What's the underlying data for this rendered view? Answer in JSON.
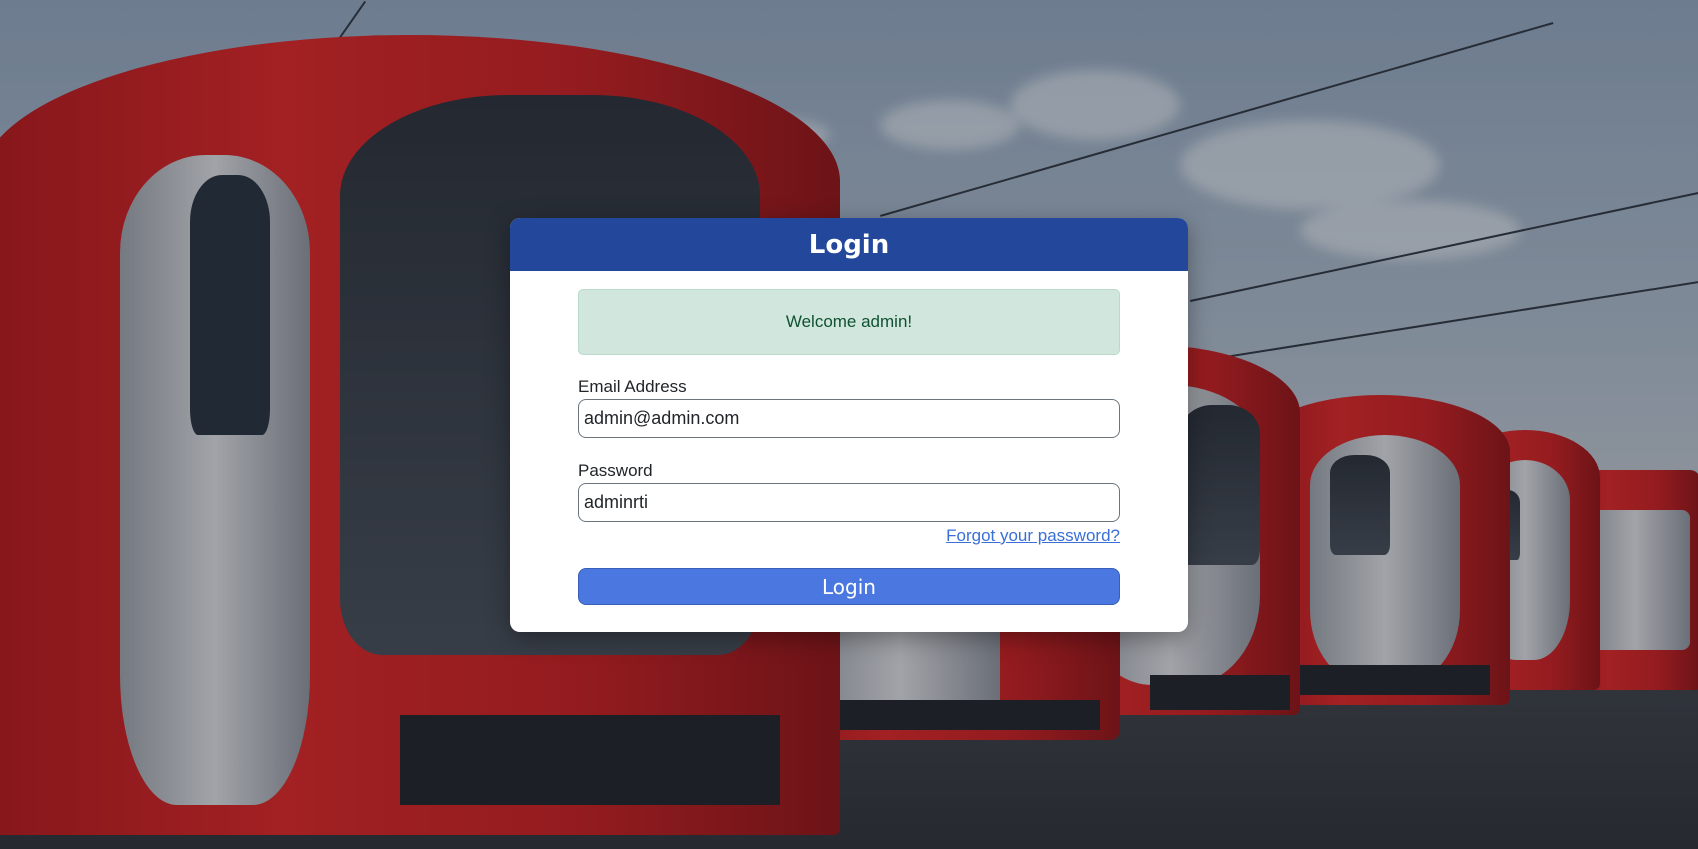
{
  "page": {
    "background_description_icon": "train-photo-background"
  },
  "login": {
    "title": "Login",
    "alert_message": "Welcome admin!",
    "email_label": "Email Address",
    "email_value": "admin@admin.com",
    "password_label": "Password",
    "password_value": "adminrti",
    "forgot_link": "Forgot your password?",
    "submit_label": "Login"
  },
  "colors": {
    "header": "#22479b",
    "button": "#4a78e0",
    "alert_bg": "#d1e7dd",
    "alert_text": "#0f5132",
    "link": "#3a6fd8"
  }
}
